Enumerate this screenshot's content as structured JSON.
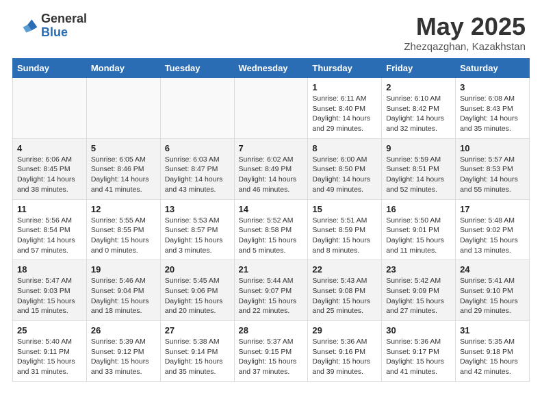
{
  "header": {
    "logo_general": "General",
    "logo_blue": "Blue",
    "title": "May 2025",
    "location": "Zhezqazghan, Kazakhstan"
  },
  "weekdays": [
    "Sunday",
    "Monday",
    "Tuesday",
    "Wednesday",
    "Thursday",
    "Friday",
    "Saturday"
  ],
  "weeks": [
    [
      {
        "day": "",
        "info": ""
      },
      {
        "day": "",
        "info": ""
      },
      {
        "day": "",
        "info": ""
      },
      {
        "day": "",
        "info": ""
      },
      {
        "day": "1",
        "info": "Sunrise: 6:11 AM\nSunset: 8:40 PM\nDaylight: 14 hours\nand 29 minutes."
      },
      {
        "day": "2",
        "info": "Sunrise: 6:10 AM\nSunset: 8:42 PM\nDaylight: 14 hours\nand 32 minutes."
      },
      {
        "day": "3",
        "info": "Sunrise: 6:08 AM\nSunset: 8:43 PM\nDaylight: 14 hours\nand 35 minutes."
      }
    ],
    [
      {
        "day": "4",
        "info": "Sunrise: 6:06 AM\nSunset: 8:45 PM\nDaylight: 14 hours\nand 38 minutes."
      },
      {
        "day": "5",
        "info": "Sunrise: 6:05 AM\nSunset: 8:46 PM\nDaylight: 14 hours\nand 41 minutes."
      },
      {
        "day": "6",
        "info": "Sunrise: 6:03 AM\nSunset: 8:47 PM\nDaylight: 14 hours\nand 43 minutes."
      },
      {
        "day": "7",
        "info": "Sunrise: 6:02 AM\nSunset: 8:49 PM\nDaylight: 14 hours\nand 46 minutes."
      },
      {
        "day": "8",
        "info": "Sunrise: 6:00 AM\nSunset: 8:50 PM\nDaylight: 14 hours\nand 49 minutes."
      },
      {
        "day": "9",
        "info": "Sunrise: 5:59 AM\nSunset: 8:51 PM\nDaylight: 14 hours\nand 52 minutes."
      },
      {
        "day": "10",
        "info": "Sunrise: 5:57 AM\nSunset: 8:53 PM\nDaylight: 14 hours\nand 55 minutes."
      }
    ],
    [
      {
        "day": "11",
        "info": "Sunrise: 5:56 AM\nSunset: 8:54 PM\nDaylight: 14 hours\nand 57 minutes."
      },
      {
        "day": "12",
        "info": "Sunrise: 5:55 AM\nSunset: 8:55 PM\nDaylight: 15 hours\nand 0 minutes."
      },
      {
        "day": "13",
        "info": "Sunrise: 5:53 AM\nSunset: 8:57 PM\nDaylight: 15 hours\nand 3 minutes."
      },
      {
        "day": "14",
        "info": "Sunrise: 5:52 AM\nSunset: 8:58 PM\nDaylight: 15 hours\nand 5 minutes."
      },
      {
        "day": "15",
        "info": "Sunrise: 5:51 AM\nSunset: 8:59 PM\nDaylight: 15 hours\nand 8 minutes."
      },
      {
        "day": "16",
        "info": "Sunrise: 5:50 AM\nSunset: 9:01 PM\nDaylight: 15 hours\nand 11 minutes."
      },
      {
        "day": "17",
        "info": "Sunrise: 5:48 AM\nSunset: 9:02 PM\nDaylight: 15 hours\nand 13 minutes."
      }
    ],
    [
      {
        "day": "18",
        "info": "Sunrise: 5:47 AM\nSunset: 9:03 PM\nDaylight: 15 hours\nand 15 minutes."
      },
      {
        "day": "19",
        "info": "Sunrise: 5:46 AM\nSunset: 9:04 PM\nDaylight: 15 hours\nand 18 minutes."
      },
      {
        "day": "20",
        "info": "Sunrise: 5:45 AM\nSunset: 9:06 PM\nDaylight: 15 hours\nand 20 minutes."
      },
      {
        "day": "21",
        "info": "Sunrise: 5:44 AM\nSunset: 9:07 PM\nDaylight: 15 hours\nand 22 minutes."
      },
      {
        "day": "22",
        "info": "Sunrise: 5:43 AM\nSunset: 9:08 PM\nDaylight: 15 hours\nand 25 minutes."
      },
      {
        "day": "23",
        "info": "Sunrise: 5:42 AM\nSunset: 9:09 PM\nDaylight: 15 hours\nand 27 minutes."
      },
      {
        "day": "24",
        "info": "Sunrise: 5:41 AM\nSunset: 9:10 PM\nDaylight: 15 hours\nand 29 minutes."
      }
    ],
    [
      {
        "day": "25",
        "info": "Sunrise: 5:40 AM\nSunset: 9:11 PM\nDaylight: 15 hours\nand 31 minutes."
      },
      {
        "day": "26",
        "info": "Sunrise: 5:39 AM\nSunset: 9:12 PM\nDaylight: 15 hours\nand 33 minutes."
      },
      {
        "day": "27",
        "info": "Sunrise: 5:38 AM\nSunset: 9:14 PM\nDaylight: 15 hours\nand 35 minutes."
      },
      {
        "day": "28",
        "info": "Sunrise: 5:37 AM\nSunset: 9:15 PM\nDaylight: 15 hours\nand 37 minutes."
      },
      {
        "day": "29",
        "info": "Sunrise: 5:36 AM\nSunset: 9:16 PM\nDaylight: 15 hours\nand 39 minutes."
      },
      {
        "day": "30",
        "info": "Sunrise: 5:36 AM\nSunset: 9:17 PM\nDaylight: 15 hours\nand 41 minutes."
      },
      {
        "day": "31",
        "info": "Sunrise: 5:35 AM\nSunset: 9:18 PM\nDaylight: 15 hours\nand 42 minutes."
      }
    ]
  ]
}
